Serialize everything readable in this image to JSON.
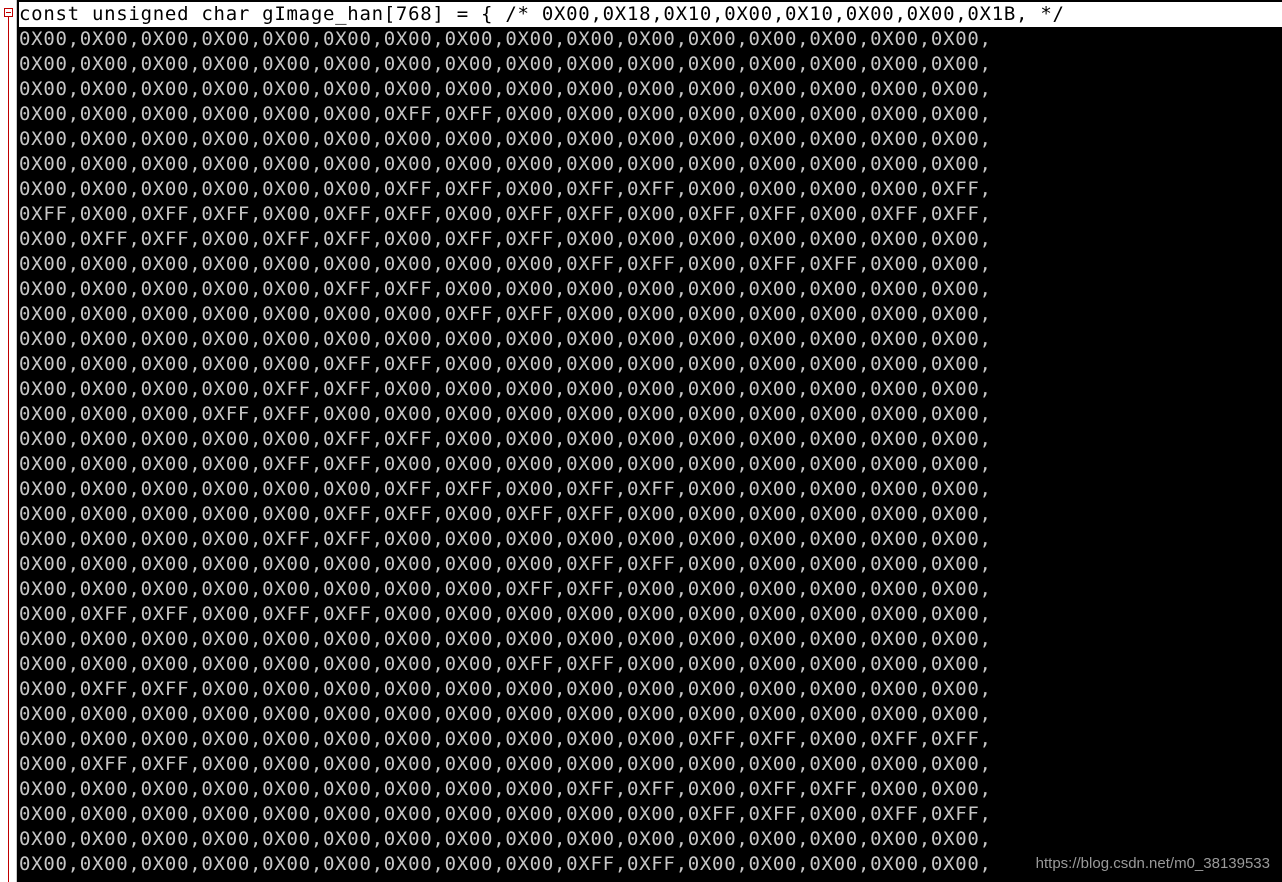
{
  "editor": {
    "lines": [
      "const unsigned char gImage_han[768] = { /* 0X00,0X18,0X10,0X00,0X10,0X00,0X00,0X1B, */",
      "0X00,0X00,0X00,0X00,0X00,0X00,0X00,0X00,0X00,0X00,0X00,0X00,0X00,0X00,0X00,0X00,",
      "0X00,0X00,0X00,0X00,0X00,0X00,0X00,0X00,0X00,0X00,0X00,0X00,0X00,0X00,0X00,0X00,",
      "0X00,0X00,0X00,0X00,0X00,0X00,0X00,0X00,0X00,0X00,0X00,0X00,0X00,0X00,0X00,0X00,",
      "0X00,0X00,0X00,0X00,0X00,0X00,0XFF,0XFF,0X00,0X00,0X00,0X00,0X00,0X00,0X00,0X00,",
      "0X00,0X00,0X00,0X00,0X00,0X00,0X00,0X00,0X00,0X00,0X00,0X00,0X00,0X00,0X00,0X00,",
      "0X00,0X00,0X00,0X00,0X00,0X00,0X00,0X00,0X00,0X00,0X00,0X00,0X00,0X00,0X00,0X00,",
      "0X00,0X00,0X00,0X00,0X00,0X00,0XFF,0XFF,0X00,0XFF,0XFF,0X00,0X00,0X00,0X00,0XFF,",
      "0XFF,0X00,0XFF,0XFF,0X00,0XFF,0XFF,0X00,0XFF,0XFF,0X00,0XFF,0XFF,0X00,0XFF,0XFF,",
      "0X00,0XFF,0XFF,0X00,0XFF,0XFF,0X00,0XFF,0XFF,0X00,0X00,0X00,0X00,0X00,0X00,0X00,",
      "0X00,0X00,0X00,0X00,0X00,0X00,0X00,0X00,0X00,0XFF,0XFF,0X00,0XFF,0XFF,0X00,0X00,",
      "0X00,0X00,0X00,0X00,0X00,0XFF,0XFF,0X00,0X00,0X00,0X00,0X00,0X00,0X00,0X00,0X00,",
      "0X00,0X00,0X00,0X00,0X00,0X00,0X00,0XFF,0XFF,0X00,0X00,0X00,0X00,0X00,0X00,0X00,",
      "0X00,0X00,0X00,0X00,0X00,0X00,0X00,0X00,0X00,0X00,0X00,0X00,0X00,0X00,0X00,0X00,",
      "0X00,0X00,0X00,0X00,0X00,0XFF,0XFF,0X00,0X00,0X00,0X00,0X00,0X00,0X00,0X00,0X00,",
      "0X00,0X00,0X00,0X00,0XFF,0XFF,0X00,0X00,0X00,0X00,0X00,0X00,0X00,0X00,0X00,0X00,",
      "0X00,0X00,0X00,0XFF,0XFF,0X00,0X00,0X00,0X00,0X00,0X00,0X00,0X00,0X00,0X00,0X00,",
      "0X00,0X00,0X00,0X00,0X00,0XFF,0XFF,0X00,0X00,0X00,0X00,0X00,0X00,0X00,0X00,0X00,",
      "0X00,0X00,0X00,0X00,0XFF,0XFF,0X00,0X00,0X00,0X00,0X00,0X00,0X00,0X00,0X00,0X00,",
      "0X00,0X00,0X00,0X00,0X00,0X00,0XFF,0XFF,0X00,0XFF,0XFF,0X00,0X00,0X00,0X00,0X00,",
      "0X00,0X00,0X00,0X00,0X00,0XFF,0XFF,0X00,0XFF,0XFF,0X00,0X00,0X00,0X00,0X00,0X00,",
      "0X00,0X00,0X00,0X00,0XFF,0XFF,0X00,0X00,0X00,0X00,0X00,0X00,0X00,0X00,0X00,0X00,",
      "0X00,0X00,0X00,0X00,0X00,0X00,0X00,0X00,0X00,0XFF,0XFF,0X00,0X00,0X00,0X00,0X00,",
      "0X00,0X00,0X00,0X00,0X00,0X00,0X00,0X00,0XFF,0XFF,0X00,0X00,0X00,0X00,0X00,0X00,",
      "0X00,0XFF,0XFF,0X00,0XFF,0XFF,0X00,0X00,0X00,0X00,0X00,0X00,0X00,0X00,0X00,0X00,",
      "0X00,0X00,0X00,0X00,0X00,0X00,0X00,0X00,0X00,0X00,0X00,0X00,0X00,0X00,0X00,0X00,",
      "0X00,0X00,0X00,0X00,0X00,0X00,0X00,0X00,0XFF,0XFF,0X00,0X00,0X00,0X00,0X00,0X00,",
      "0X00,0XFF,0XFF,0X00,0X00,0X00,0X00,0X00,0X00,0X00,0X00,0X00,0X00,0X00,0X00,0X00,",
      "0X00,0X00,0X00,0X00,0X00,0X00,0X00,0X00,0X00,0X00,0X00,0X00,0X00,0X00,0X00,0X00,",
      "0X00,0X00,0X00,0X00,0X00,0X00,0X00,0X00,0X00,0X00,0X00,0XFF,0XFF,0X00,0XFF,0XFF,",
      "0X00,0XFF,0XFF,0X00,0X00,0X00,0X00,0X00,0X00,0X00,0X00,0X00,0X00,0X00,0X00,0X00,",
      "0X00,0X00,0X00,0X00,0X00,0X00,0X00,0X00,0X00,0XFF,0XFF,0X00,0XFF,0XFF,0X00,0X00,",
      "0X00,0X00,0X00,0X00,0X00,0X00,0X00,0X00,0X00,0X00,0X00,0XFF,0XFF,0X00,0XFF,0XFF,",
      "0X00,0X00,0X00,0X00,0X00,0X00,0X00,0X00,0X00,0X00,0X00,0X00,0X00,0X00,0X00,0X00,",
      "0X00,0X00,0X00,0X00,0X00,0X00,0X00,0X00,0X00,0XFF,0XFF,0X00,0X00,0X00,0X00,0X00,"
    ],
    "watermark": "https://blog.csdn.net/m0_38139533",
    "colors": {
      "background": "#000000",
      "code_text": "#c6c6c6",
      "current_line_background": "#ffffff",
      "current_line_text": "#000000",
      "fold_marker": "#c00000"
    },
    "icons": {
      "fold_toggle": "collapse-minus-icon"
    }
  }
}
